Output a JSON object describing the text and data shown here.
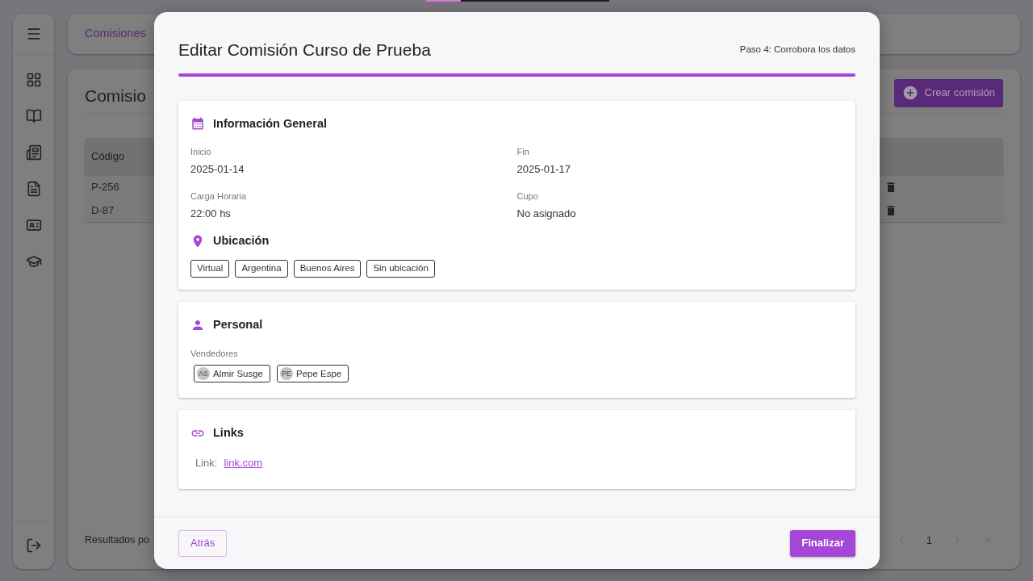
{
  "loading_bar": {
    "level": 0.19
  },
  "breadcrumb": "Comisiones",
  "page": {
    "title": "Comisio",
    "create_button": "Crear comisión",
    "table": {
      "columns": [
        "Código"
      ],
      "rows": [
        {
          "code": "P-256"
        },
        {
          "code": "D-87"
        }
      ]
    },
    "footer_label": "Resultados po",
    "pagination": {
      "page": "1"
    }
  },
  "modal": {
    "title": "Editar Comisión Curso de Prueba",
    "step": "Paso 4: Corrobora los datos",
    "sections": [
      {
        "kind": "general",
        "title": "Información General",
        "fields": [
          {
            "label": "Inicio",
            "value": "2025-01-14"
          },
          {
            "label": "Fin",
            "value": "2025-01-17"
          },
          {
            "label": "Carga Horaria",
            "value": "22:00 hs"
          },
          {
            "label": "Cupo",
            "value": "No asignado"
          }
        ],
        "location_title": "Ubicación",
        "locations": [
          "Virtual",
          "Argentina",
          "Buenos Aires",
          "Sin ubicación"
        ]
      },
      {
        "kind": "staff",
        "title": "Personal",
        "label": "Vendedores",
        "people": [
          {
            "initials": "AS",
            "name": "Almir Susge"
          },
          {
            "initials": "PE",
            "name": "Pepe Espe"
          }
        ]
      },
      {
        "kind": "links",
        "title": "Links",
        "links": [
          {
            "label": "Link:",
            "url": "link.com"
          }
        ]
      }
    ],
    "back_button": "Atrás",
    "finish_button": "Finalizar"
  }
}
